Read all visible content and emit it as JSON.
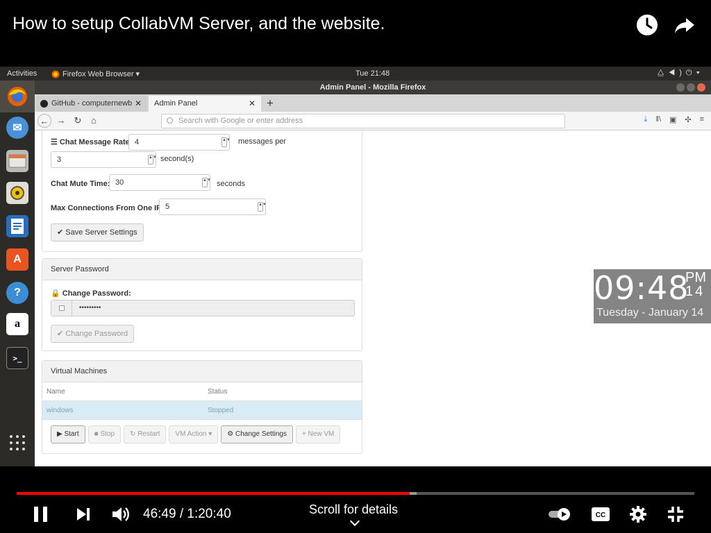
{
  "video": {
    "title": "How to setup CollabVM Server, and the website.",
    "current_time": "46:49",
    "separator": " / ",
    "duration": "1:20:40",
    "played_fraction": 0.58,
    "buffered_fraction": 0.59,
    "scroll_hint": "Scroll for details",
    "accent_color": "#ff0000"
  },
  "os": {
    "activities": "Activities",
    "app_menu": "Firefox Web Browser ▾",
    "clock": "Tue 21:48"
  },
  "firefox": {
    "window_title": "Admin Panel - Mozilla Firefox",
    "tabs": [
      {
        "label": "GitHub - computernewb"
      },
      {
        "label": "Admin Panel"
      }
    ],
    "url_placeholder": "Search with Google or enter address"
  },
  "settings": {
    "chat_rate_label": "Chat Message Rate:",
    "chat_rate_value": "4",
    "chat_rate_unit": "messages per",
    "chat_rate_seconds": "3",
    "chat_rate_seconds_unit": "second(s)",
    "mute_label": "Chat Mute Time:",
    "mute_value": "30",
    "mute_unit": "seconds",
    "maxconn_label": "Max Connections From One IP:",
    "maxconn_value": "5",
    "save_button": "Save Server Settings"
  },
  "password_panel": {
    "heading": "Server Password",
    "label": "Change Password:",
    "value": "•••••••••",
    "button": "Change Password"
  },
  "vm_panel": {
    "heading": "Virtual Machines",
    "columns": [
      "Name",
      "Status"
    ],
    "rows": [
      {
        "name": "windows",
        "status": "Stopped"
      }
    ],
    "actions": {
      "start": "Start",
      "stop": "Stop",
      "restart": "Restart",
      "vm_action": "VM Action",
      "change_settings": "Change Settings",
      "new_vm": "New VM"
    }
  },
  "clock_widget": {
    "time": "09:48",
    "ampm": "PM",
    "seconds": "14",
    "date": "Tuesday - January 14"
  }
}
